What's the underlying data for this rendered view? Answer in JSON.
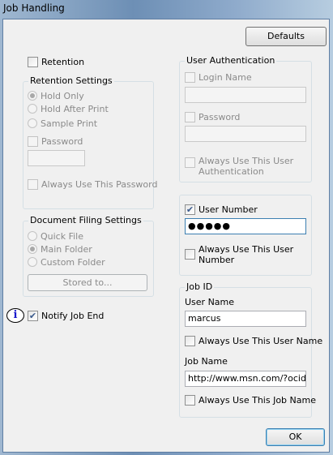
{
  "window": {
    "title": "Job Handling"
  },
  "buttons": {
    "defaults": "Defaults",
    "stored_to": "Stored to...",
    "ok": "OK"
  },
  "retention": {
    "label": "Retention",
    "checked": false,
    "settings": {
      "title": "Retention Settings",
      "options": [
        "Hold Only",
        "Hold After Print",
        "Sample Print"
      ],
      "selected": "Hold Only",
      "password_label": "Password",
      "password_value": "",
      "always_use_password": "Always Use This Password"
    }
  },
  "document_filing": {
    "title": "Document Filing Settings",
    "options": [
      "Quick File",
      "Main Folder",
      "Custom Folder"
    ],
    "selected": "Main Folder"
  },
  "notify": {
    "label": "Notify Job End",
    "checked": true,
    "icon": "info-icon",
    "icon_glyph": "i"
  },
  "user_auth": {
    "title": "User Authentication",
    "login_name_label": "Login Name",
    "login_name_value": "",
    "password_label": "Password",
    "password_value": "",
    "always_use_label_1": "Always Use This User",
    "always_use_label_2": "Authentication"
  },
  "user_number": {
    "label": "User Number",
    "checked": true,
    "value": "●●●●●",
    "always_use_label_1": "Always Use This User",
    "always_use_label_2": "Number"
  },
  "job_id": {
    "title": "Job ID",
    "user_name_label": "User Name",
    "user_name_value": "marcus",
    "always_user_name": "Always Use This User Name",
    "job_name_label": "Job Name",
    "job_name_value": "http://www.msn.com/?ocid=ie",
    "always_job_name": "Always Use This Job Name"
  },
  "check_glyph": "✔"
}
